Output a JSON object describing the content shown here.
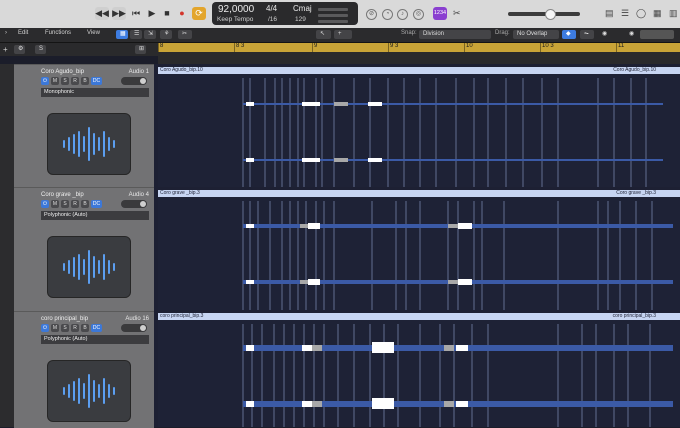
{
  "transport": {
    "tempo": "92,0000",
    "tempo_label": "Keep Tempo",
    "time_signature": "4/4",
    "time_division": "/16",
    "key": "Cmaj",
    "bpm_readout": "129",
    "badge": "1234"
  },
  "toolbar": {
    "edit": "Edit",
    "functions": "Functions",
    "view": "View",
    "snap_label": "Snap:",
    "snap_value": "Division",
    "drag_label": "Drag:",
    "drag_value": "No Overlap",
    "add_button": "+",
    "s_button": "S"
  },
  "ruler": {
    "marks": [
      "8",
      "8 3",
      "9",
      "9 3",
      "10",
      "10 3",
      "11"
    ]
  },
  "tracks": [
    {
      "name": "Coro Agudo_bip",
      "channel": "Audio 1",
      "mode": "Monophonic",
      "region": "Coro Agudo_bip.10",
      "region_end": "Coro Agudo_bip.10"
    },
    {
      "name": "Coro grave _bip",
      "channel": "Audio 4",
      "mode": "Polyphonic (Auto)",
      "region": "Coro grave _bip.3",
      "region_end": "Coro grave _bip.3"
    },
    {
      "name": "coro principal_bip",
      "channel": "Audio 16",
      "mode": "Polyphonic (Auto)",
      "region": "coro principal_bip.3",
      "region_end": "coro principal_bip.3"
    }
  ],
  "track_buttons": [
    "M",
    "S",
    "R",
    "B",
    "DC"
  ],
  "colors": {
    "accent": "#3c78d8",
    "ruler": "#c9a437",
    "region_header": "#c7d5f2",
    "cycle": "#e3a52c"
  }
}
